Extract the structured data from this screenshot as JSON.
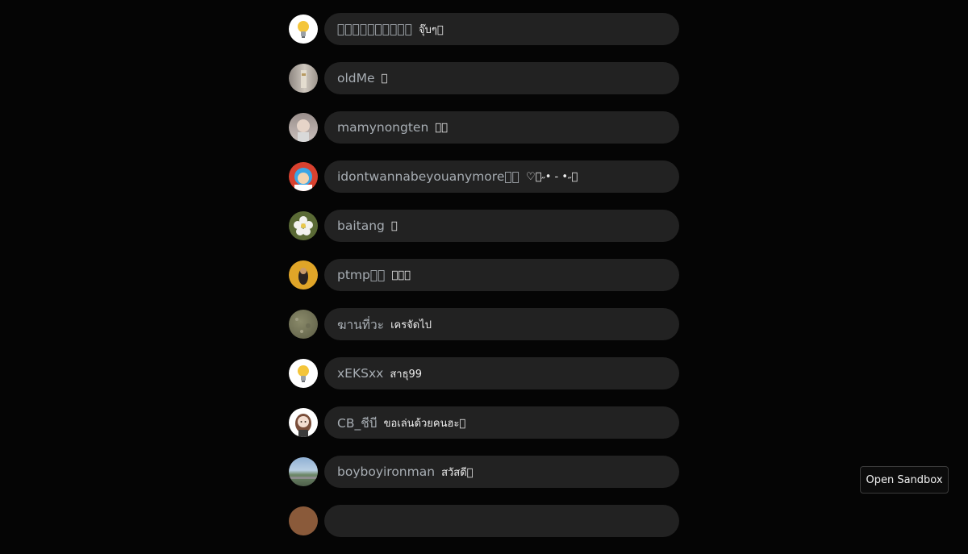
{
  "comments": [
    {
      "username": "􏿿􏿿􏿿􏿿􏿿􏿿􏿿􏿿􏿿􏿿",
      "text": "จุ๊บๆ􏿿",
      "avatar": "lightbulb-avatar"
    },
    {
      "username": "oldMe",
      "text": "􏿿",
      "avatar": "photo-avatar"
    },
    {
      "username": "mamynongten",
      "text": "􏿿􏿿",
      "avatar": "photo-avatar"
    },
    {
      "username": "idontwannabeyouanymore􏿿􏿿",
      "text": "♡􏿿˶• - •˶􏿿",
      "avatar": "cartoon-avatar"
    },
    {
      "username": "baitang",
      "text": "􏿿",
      "avatar": "flower-avatar"
    },
    {
      "username": "ptmp􏿿􏿿",
      "text": "􏿿􏿿􏿿",
      "avatar": "photo-avatar"
    },
    {
      "username": "ฆานที่วะ",
      "text": "เครจัดไป",
      "avatar": "texture-avatar"
    },
    {
      "username": "xEKSxx",
      "text": "สาธุ99",
      "avatar": "lightbulb-avatar"
    },
    {
      "username": "CB_ชีบี",
      "text": "ขอเล่นด้วยคนฮะ􏿿",
      "avatar": "girl-avatar"
    },
    {
      "username": "boyboyironman",
      "text": "สวัสดี􏿿",
      "avatar": "landscape-avatar"
    }
  ],
  "sandbox_button": {
    "label": "Open Sandbox"
  }
}
